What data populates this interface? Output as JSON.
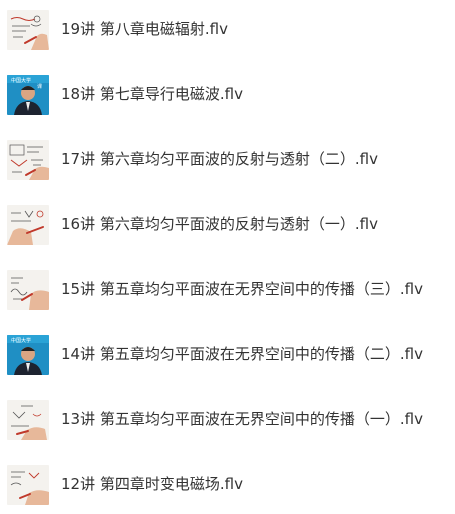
{
  "files": [
    {
      "name": "19讲 第八章电磁辐射.flv",
      "thumbnail": "handwriting-notes"
    },
    {
      "name": "18讲 第七章导行电磁波.flv",
      "thumbnail": "lecturer-blue-screen"
    },
    {
      "name": "17讲 第六章均匀平面波的反射与透射（二）.flv",
      "thumbnail": "handwriting-notes"
    },
    {
      "name": "16讲 第六章均匀平面波的反射与透射（一）.flv",
      "thumbnail": "handwriting-notes"
    },
    {
      "name": "15讲 第五章均匀平面波在无界空间中的传播（三）.flv",
      "thumbnail": "handwriting-notes"
    },
    {
      "name": "14讲 第五章均匀平面波在无界空间中的传播（二）.flv",
      "thumbnail": "lecturer-blue-screen"
    },
    {
      "name": "13讲 第五章均匀平面波在无界空间中的传播（一）.flv",
      "thumbnail": "handwriting-notes"
    },
    {
      "name": "12讲 第四章时变电磁场.flv",
      "thumbnail": "handwriting-notes"
    }
  ],
  "colors": {
    "text": "#333333",
    "lecture_blue": "#1f8fc4",
    "paper": "#f4f2ee",
    "ink": "#c0392b",
    "hand": "#e7b89a"
  }
}
